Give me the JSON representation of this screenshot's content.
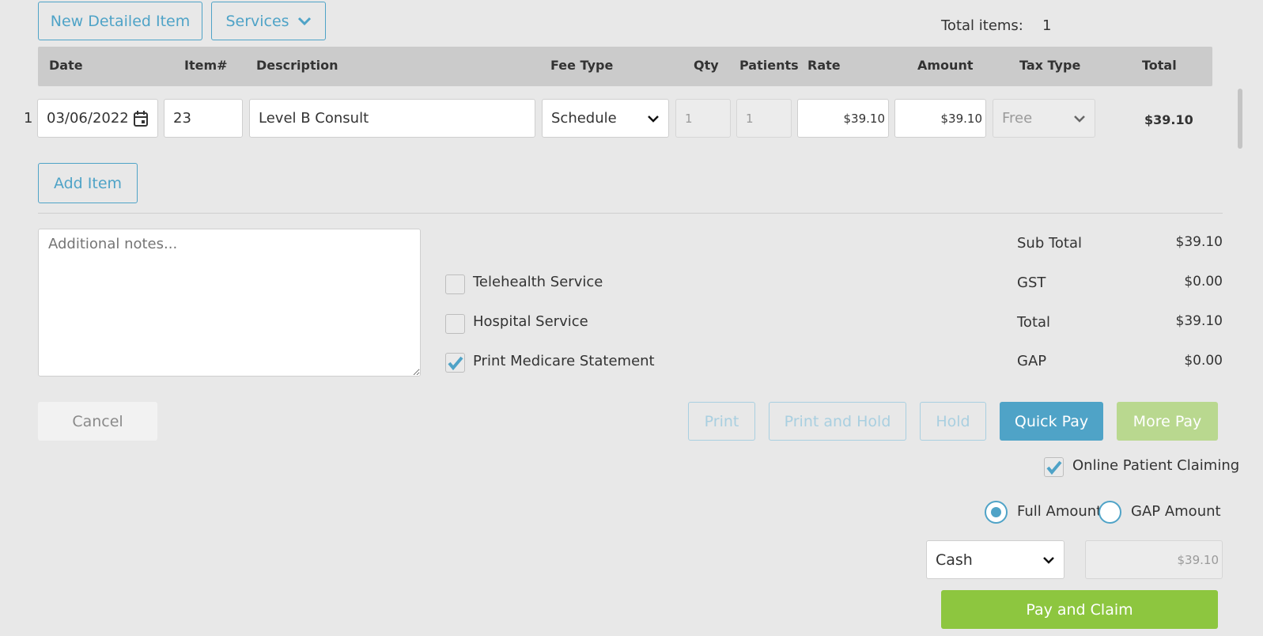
{
  "toolbar": {
    "new_detailed_item": "New Detailed Item",
    "services": "Services"
  },
  "summary_count": {
    "label": "Total items:",
    "value": "1"
  },
  "table": {
    "headers": {
      "date": "Date",
      "item": "Item#",
      "description": "Description",
      "fee_type": "Fee Type",
      "qty": "Qty",
      "patients": "Patients",
      "rate": "Rate",
      "amount": "Amount",
      "tax_type": "Tax Type",
      "total": "Total"
    },
    "rows": [
      {
        "index": "1",
        "date": "03/06/2022",
        "item": "23",
        "description": "Level B Consult",
        "fee_type": "Schedule",
        "qty": "1",
        "patients": "1",
        "rate": "$39.10",
        "amount": "$39.10",
        "tax_type": "Free",
        "total": "$39.10"
      }
    ]
  },
  "add_item": "Add Item",
  "notes": {
    "placeholder": "Additional notes..."
  },
  "options": {
    "telehealth": {
      "label": "Telehealth Service",
      "checked": false
    },
    "hospital": {
      "label": "Hospital Service",
      "checked": false
    },
    "print_medicare": {
      "label": "Print Medicare Statement",
      "checked": true
    }
  },
  "totals": {
    "sub_total": {
      "label": "Sub Total",
      "value": "$39.10"
    },
    "gst": {
      "label": "GST",
      "value": "$0.00"
    },
    "total": {
      "label": "Total",
      "value": "$39.10"
    },
    "gap": {
      "label": "GAP",
      "value": "$0.00"
    }
  },
  "actions": {
    "cancel": "Cancel",
    "print": "Print",
    "print_and_hold": "Print and Hold",
    "hold": "Hold",
    "quick_pay": "Quick Pay",
    "more_pay": "More Pay"
  },
  "claiming": {
    "online_patient_claiming": {
      "label": "Online Patient Claiming",
      "checked": true
    },
    "full_amount": {
      "label": "Full Amount",
      "selected": true
    },
    "gap_amount": {
      "label": "GAP Amount",
      "selected": false
    }
  },
  "payment": {
    "method": "Cash",
    "amount": "$39.10",
    "pay_and_claim": "Pay and Claim"
  },
  "colors": {
    "accent": "#4fa3c7",
    "green": "#8dc63f",
    "light_green": "#b9d88f"
  }
}
